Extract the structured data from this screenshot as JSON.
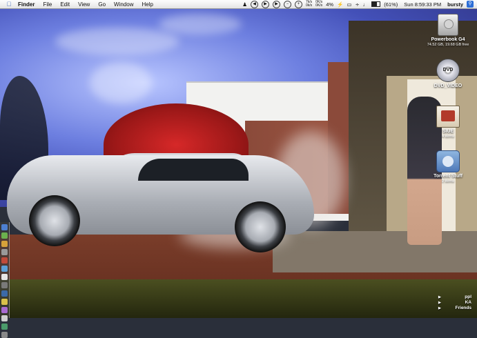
{
  "menubar": {
    "app_name": "Finder",
    "menus": [
      "File",
      "Edit",
      "View",
      "Go",
      "Window",
      "Help"
    ],
    "status": {
      "net_rates_top": "7k/s",
      "net_rates_bottom": "0k/s",
      "cpu_rates_top": "0K/s",
      "cpu_rates_bottom": "0K/s",
      "cpu_percent": "4%",
      "battery_percent": "(61%)",
      "clock": "Sun 8:59:33 PM",
      "user": "bursty"
    }
  },
  "desktop_icons": [
    {
      "label": "Powerbook G4",
      "sub": "74.52 GB, 19.68 GB free",
      "icon": "hard-drive-icon"
    },
    {
      "label": "DVD_VIDEO",
      "sub": "",
      "icon": "dvd-icon"
    },
    {
      "label": "SIUE",
      "sub": "4 items",
      "icon": "folder-icon"
    },
    {
      "label": "Torrent Stuff",
      "sub": "2 items",
      "icon": "folder-icon"
    }
  ],
  "dvd_badge": "DVD",
  "corner_list": [
    "ppl",
    "KA",
    "Friends"
  ],
  "dock_colors": [
    "#4d7fd1",
    "#6bb04e",
    "#d7a23a",
    "#9a9a9a",
    "#c04a3a",
    "#5ca0d8",
    "#e6e6e6",
    "#7a7a7a",
    "#3c6aa8",
    "#d9c04a",
    "#a86ad1",
    "#cfcfcf",
    "#4a9a6a",
    "#888888"
  ]
}
